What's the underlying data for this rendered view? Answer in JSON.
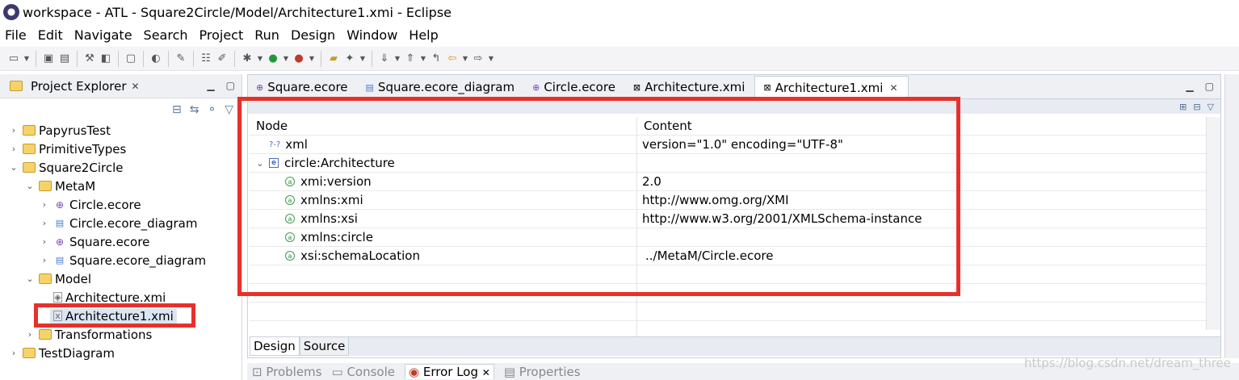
{
  "window": {
    "title": "workspace - ATL - Square2Circle/Model/Architecture1.xmi - Eclipse"
  },
  "menu": [
    "File",
    "Edit",
    "Navigate",
    "Search",
    "Project",
    "Run",
    "Design",
    "Window",
    "Help"
  ],
  "project_explorer": {
    "title": "Project Explorer",
    "tree": [
      {
        "label": "PapyrusTest",
        "icon": "project-folder-icon",
        "depth": 0,
        "expanded": false
      },
      {
        "label": "PrimitiveTypes",
        "icon": "project-folder-icon",
        "depth": 0,
        "expanded": false
      },
      {
        "label": "Square2Circle",
        "icon": "project-folder-icon",
        "depth": 0,
        "expanded": true
      },
      {
        "label": "MetaM",
        "icon": "folder-icon",
        "depth": 1,
        "expanded": true
      },
      {
        "label": "Circle.ecore",
        "icon": "ecore-file-icon",
        "depth": 2,
        "expanded": false
      },
      {
        "label": "Circle.ecore_diagram",
        "icon": "diagram-file-icon",
        "depth": 2,
        "expanded": false
      },
      {
        "label": "Square.ecore",
        "icon": "ecore-file-icon",
        "depth": 2,
        "expanded": false
      },
      {
        "label": "Square.ecore_diagram",
        "icon": "diagram-file-icon",
        "depth": 2,
        "expanded": false
      },
      {
        "label": "Model",
        "icon": "folder-icon",
        "depth": 1,
        "expanded": true
      },
      {
        "label": "Architecture.xmi",
        "icon": "xmi-file-icon",
        "depth": 2
      },
      {
        "label": "Architecture1.xmi",
        "icon": "xmi-file-icon",
        "depth": 2,
        "selected": true
      },
      {
        "label": "Transformations",
        "icon": "folder-icon",
        "depth": 1,
        "expanded": false
      },
      {
        "label": "TestDiagram",
        "icon": "project-folder-icon",
        "depth": 0,
        "expanded": false
      }
    ]
  },
  "editor": {
    "tabs": [
      {
        "label": "Square.ecore",
        "icon": "ecore-file-icon"
      },
      {
        "label": "Square.ecore_diagram",
        "icon": "diagram-file-icon"
      },
      {
        "label": "Circle.ecore",
        "icon": "ecore-file-icon"
      },
      {
        "label": "Architecture.xmi",
        "icon": "xmi-file-icon"
      },
      {
        "label": "Architecture1.xmi",
        "icon": "xmi-file-icon",
        "active": true
      }
    ],
    "grid_headers": {
      "node": "Node",
      "content": "Content"
    },
    "rows": [
      {
        "node": "xml",
        "content": "version=\"1.0\" encoding=\"UTF-8\"",
        "icon": "processing-instruction-icon",
        "indent": 1
      },
      {
        "node": "circle:Architecture",
        "content": "",
        "icon": "element-icon",
        "indent": 0,
        "expanded": true
      },
      {
        "node": "xmi:version",
        "content": "2.0",
        "icon": "attribute-icon",
        "indent": 2
      },
      {
        "node": "xmlns:xmi",
        "content": "http://www.omg.org/XMI",
        "icon": "attribute-icon",
        "indent": 2
      },
      {
        "node": "xmlns:xsi",
        "content": "http://www.w3.org/2001/XMLSchema-instance",
        "icon": "attribute-icon",
        "indent": 2
      },
      {
        "node": "xmlns:circle",
        "content": "",
        "icon": "attribute-icon",
        "indent": 2
      },
      {
        "node": "xsi:schemaLocation",
        "content": "../MetaM/Circle.ecore",
        "icon": "attribute-icon",
        "indent": 2
      }
    ],
    "bottom_tabs": [
      {
        "label": "Design",
        "active": true
      },
      {
        "label": "Source"
      }
    ]
  },
  "views": [
    {
      "label": "Problems"
    },
    {
      "label": "Console"
    },
    {
      "label": "Error Log",
      "active": true
    },
    {
      "label": "Properties"
    }
  ],
  "watermark": "https://blog.csdn.net/dream_three",
  "colors": {
    "highlight": "#e8302b",
    "selection": "#dbe6f4"
  }
}
